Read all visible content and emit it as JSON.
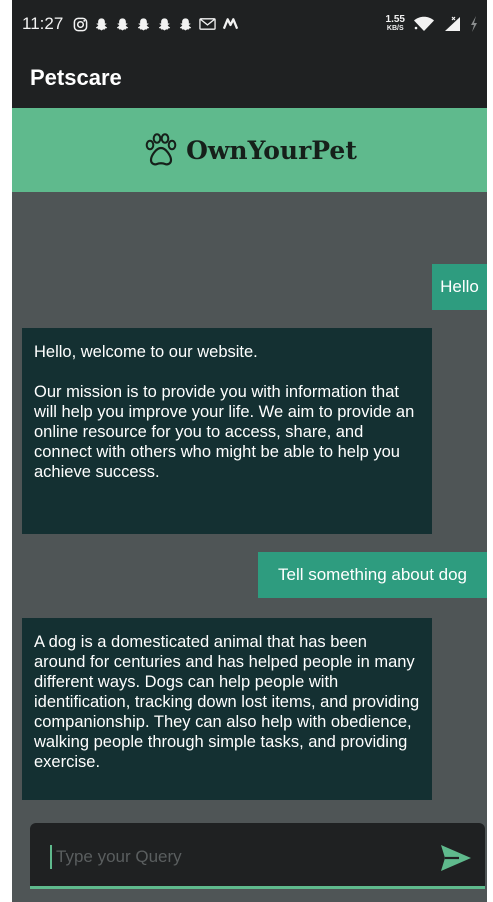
{
  "status_bar": {
    "time": "11:27",
    "notification_icons": [
      "instagram-icon",
      "snapchat-icon",
      "snapchat-icon",
      "snapchat-icon",
      "snapchat-icon",
      "snapchat-icon",
      "gmail-icon",
      "m-app-icon"
    ],
    "speed_value": "1.55",
    "speed_unit": "KB/S"
  },
  "app_bar": {
    "title": "Petscare"
  },
  "banner": {
    "logo_text": "OwnYourPet"
  },
  "messages": [
    {
      "from": "user",
      "text": "Hello"
    },
    {
      "from": "bot",
      "text": "Hello, welcome to our website.\n\nOur mission is to provide you with information that will help you improve your life. We aim to provide an online resource for you to access, share, and connect with others who might be able to help you achieve success."
    },
    {
      "from": "user",
      "text": "Tell something about dog"
    },
    {
      "from": "bot",
      "text": "A dog is a domesticated animal that has been around for centuries and has helped people in many different ways. Dogs can help people with identification, tracking down lost items, and providing companionship. They can also help with obedience, walking people through simple tasks, and providing exercise."
    }
  ],
  "composer": {
    "placeholder": "Type your Query",
    "value": ""
  },
  "colors": {
    "accent": "#5fba8d",
    "user_bubble": "#2e9c7f",
    "bot_bubble": "#143032",
    "background": "#4f5556",
    "bar": "#1f2122"
  }
}
